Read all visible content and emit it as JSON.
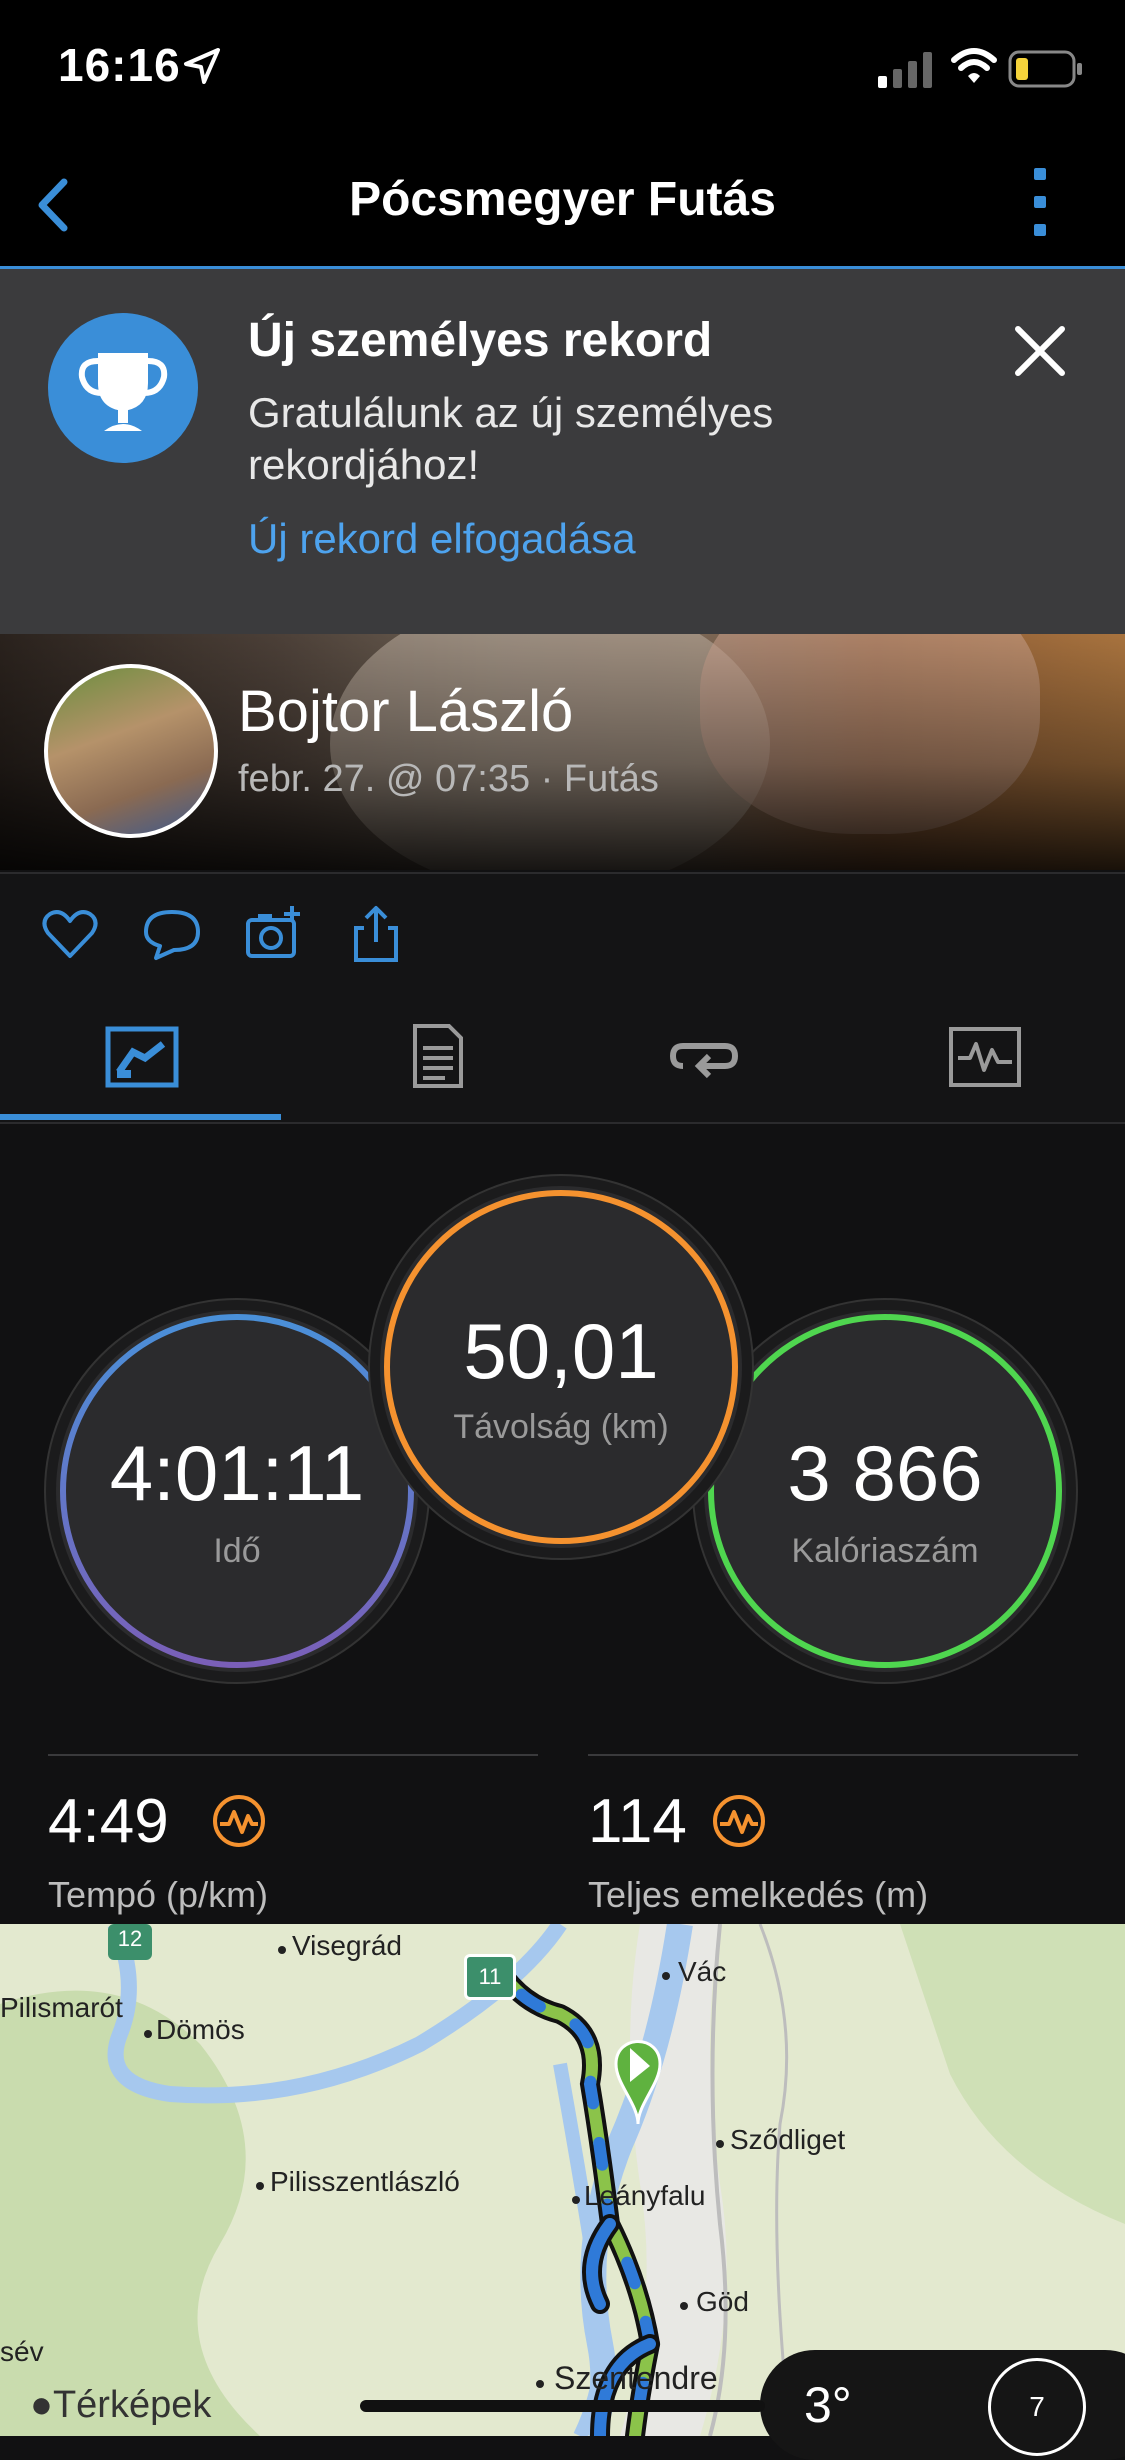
{
  "status_bar": {
    "time": "16:16"
  },
  "nav": {
    "title": "Pócsmegyer Futás"
  },
  "banner": {
    "title": "Új személyes rekord",
    "message": "Gratulálunk az új személyes rekordjához!",
    "link": "Új rekord elfogadása"
  },
  "profile": {
    "name": "Bojtor László",
    "meta": "febr. 27. @ 07:35 · Futás"
  },
  "actions": [
    "heart-icon",
    "comment-icon",
    "add-photo-icon",
    "share-icon"
  ],
  "tabs": [
    "overview-tab",
    "details-tab",
    "laps-tab",
    "charts-tab"
  ],
  "stats": {
    "distance": {
      "value": "50,01",
      "label": "Távolság (km)",
      "color": "#f5922f"
    },
    "time": {
      "value": "4:01:11",
      "label": "Idő",
      "color": "#4a90d9"
    },
    "calories": {
      "value": "3 866",
      "label": "Kalóriaszám",
      "color": "#4fd64f"
    },
    "pace": {
      "value": "4:49",
      "label": "Tempó (p/km)"
    },
    "elevation": {
      "value": "114",
      "label": "Teljes emelkedés (m)"
    }
  },
  "map": {
    "places": [
      "Visegrád",
      "Vác",
      "Pilismarót",
      "Dömös",
      "Sződliget",
      "Pilisszentlászló",
      "Leányfalu",
      "Göd",
      "Szentendre",
      "sév"
    ],
    "road_badges": [
      "12",
      "11"
    ],
    "attribution": "Térképek",
    "temperature": "3°",
    "compass": "7"
  },
  "colors": {
    "accent": "#3a8ed8",
    "route_green": "#8bc34a",
    "route_blue": "#2f7ad8"
  }
}
